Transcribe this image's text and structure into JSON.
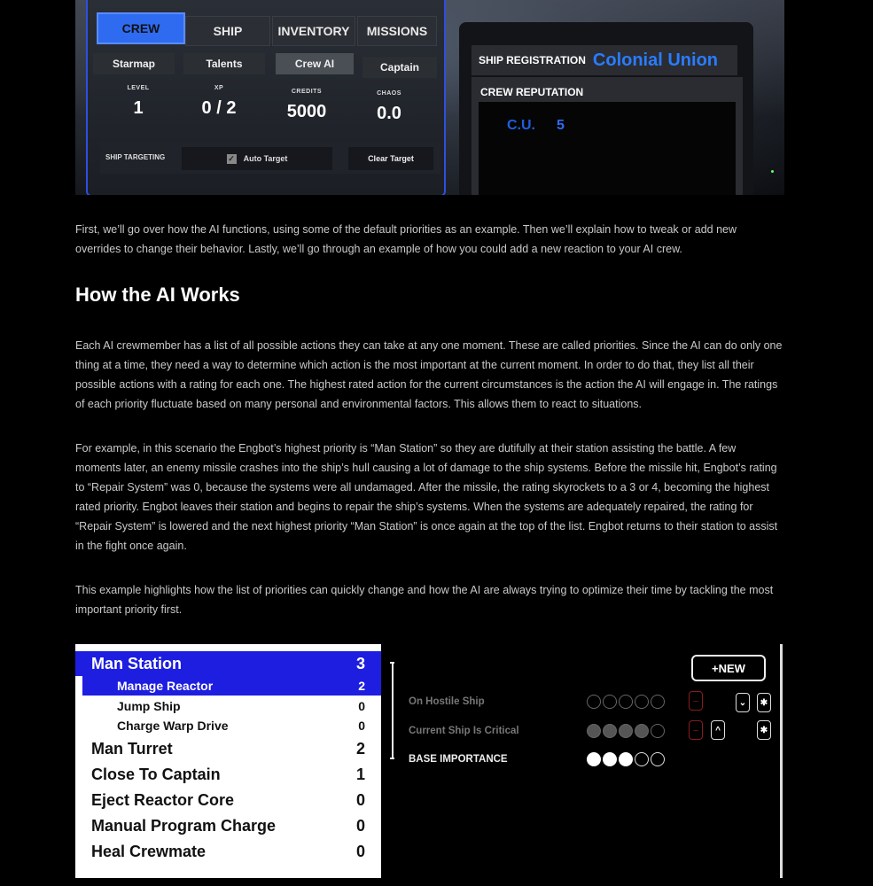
{
  "game_ui": {
    "tabs": [
      "CREW",
      "SHIP",
      "INVENTORY",
      "MISSIONS"
    ],
    "subtabs": [
      "Starmap",
      "Talents",
      "Crew AI",
      "Captain"
    ],
    "stats": [
      {
        "label": "LEVEL",
        "value": "1"
      },
      {
        "label": "XP",
        "value": "0 / 2"
      },
      {
        "label": "CREDITS",
        "value": "5000"
      },
      {
        "label": "CHAOS",
        "value": "0.0"
      }
    ],
    "targeting": {
      "label": "SHIP TARGETING",
      "auto_target": "Auto Target",
      "clear_target": "Clear Target"
    },
    "registration": {
      "label": "SHIP REGISTRATION",
      "value": "Colonial Union"
    },
    "reputation": {
      "label": "CREW REPUTATION",
      "faction": "C.U.",
      "value": "5"
    }
  },
  "article": {
    "intro": "First, we’ll go over how the AI functions, using some of the default priorities as an example. Then we’ll explain how to tweak or add new overrides to change their behavior. Lastly, we’ll go through an example of how you could add a new reaction to your AI crew.",
    "heading": "How the AI Works",
    "p1": "Each AI crewmember has a list of all possible actions they can take at any one moment. These are called priorities. Since the AI can do only one thing at a time, they need a way to determine which action is the most important at the current moment. In order to do that, they list all their possible actions with a rating for each one. The highest rated action for the current circumstances is the action the AI will engage in. The ratings of each priority fluctuate based on many personal and environmental factors. This allows them to react to situations.",
    "p2": "For example, in this scenario the Engbot’s highest priority is “Man Station” so they are dutifully at their station assisting the battle. A few moments later, an enemy missile crashes into the ship’s hull causing a lot of damage to the ship systems. Before the missile hit, Engbot’s rating to “Repair System” was 0, because the systems were all undamaged. After the missile, the rating skyrockets to a 3 or 4, becoming the highest rated priority. Engbot leaves their station and begins to repair the ship’s systems. When the systems are adequately repaired, the rating for “Repair System” is lowered and the next highest priority “Man Station” is once again at the top of the list. Engbot returns to their station to assist in the fight once again.",
    "p3": "This example highlights how the list of priorities can quickly change and how the AI are always trying to optimize their time by tackling the most important priority first."
  },
  "ai_panel": {
    "priorities": [
      {
        "name": "Man Station",
        "score": "3"
      },
      {
        "name": "Manage Reactor",
        "score": "2"
      },
      {
        "name": "Jump Ship",
        "score": "0"
      },
      {
        "name": "Charge Warp Drive",
        "score": "0"
      },
      {
        "name": "Man Turret",
        "score": "2"
      },
      {
        "name": "Close To Captain",
        "score": "1"
      },
      {
        "name": "Eject Reactor Core",
        "score": "0"
      },
      {
        "name": "Manual Program Charge",
        "score": "0"
      },
      {
        "name": "Heal Crewmate",
        "score": "0"
      }
    ],
    "new_button": "+NEW",
    "overrides": [
      {
        "label": "On Hostile Ship",
        "filled": 0,
        "total": 5
      },
      {
        "label": "Current Ship Is Critical",
        "filled": 4,
        "total": 5
      },
      {
        "label": "BASE IMPORTANCE",
        "filled": 3,
        "total": 5
      }
    ],
    "colors": {
      "selected": "#1d1ee0",
      "accent_blue": "#2f6bf0",
      "danger": "#8a1c1c"
    }
  }
}
